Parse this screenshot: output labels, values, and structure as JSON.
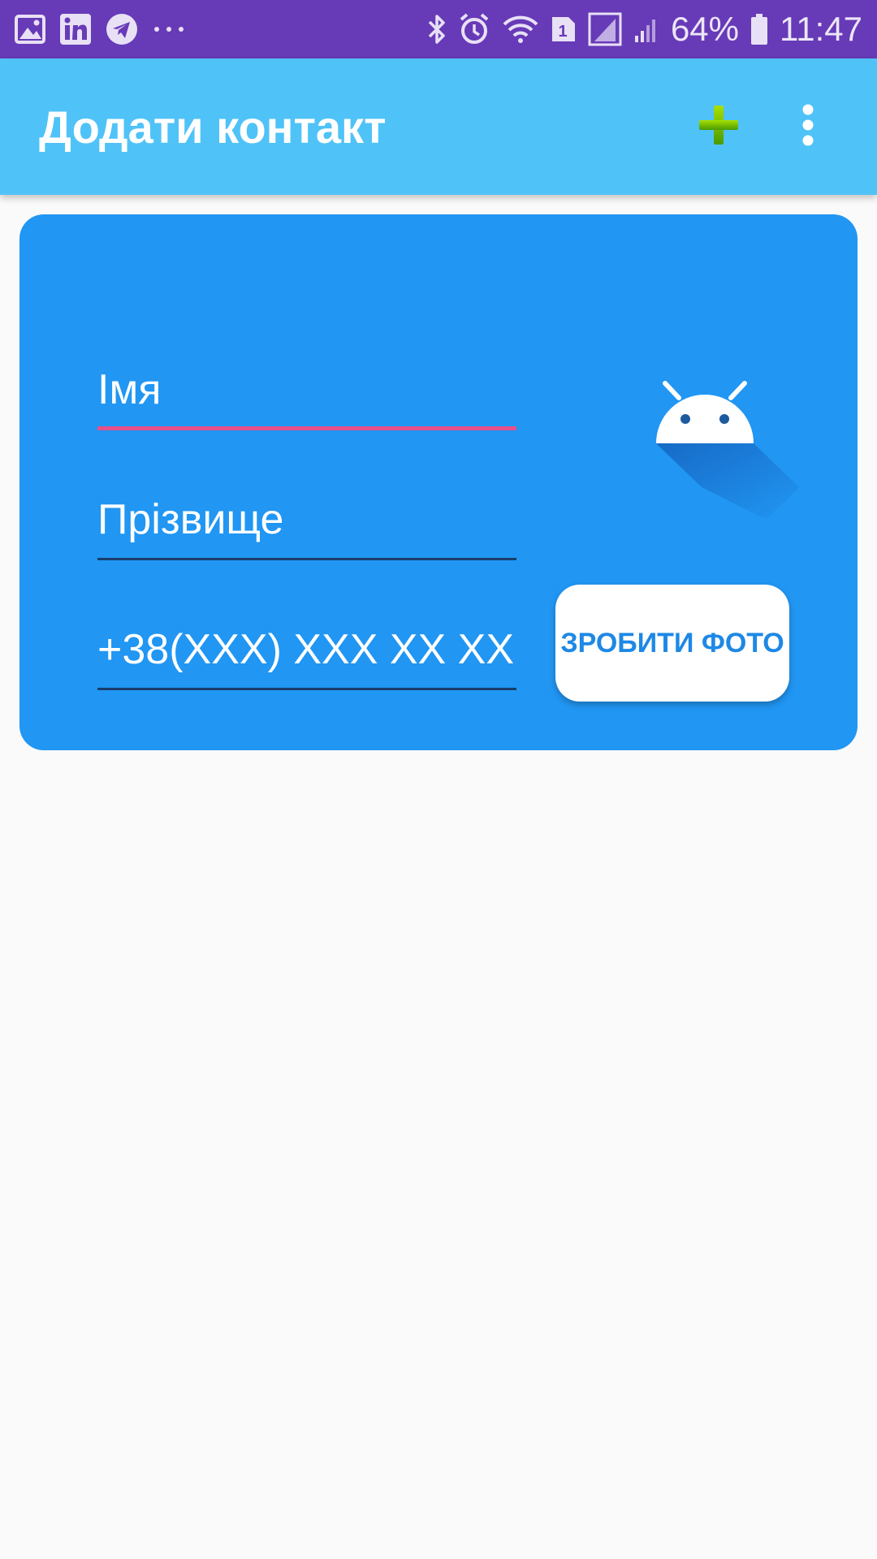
{
  "status_bar": {
    "battery": "64%",
    "time": "11:47",
    "sim_badge": "1",
    "notification_icons": [
      "gallery-icon",
      "linkedin-icon",
      "telegram-icon",
      "more-notifications-icon"
    ],
    "system_icons": [
      "bluetooth-icon",
      "alarm-icon",
      "wifi-icon",
      "sim-icon",
      "signal-icon",
      "signal-2-icon",
      "battery-icon"
    ]
  },
  "app_bar": {
    "title": "Додати контакт",
    "actions": [
      "add-icon",
      "overflow-menu-icon"
    ],
    "add_icon_color": "#7cc800",
    "background": "#4fc3f7"
  },
  "form": {
    "first_name": {
      "placeholder": "Імя",
      "value": ""
    },
    "last_name": {
      "placeholder": "Прізвище",
      "value": ""
    },
    "phone": {
      "placeholder": "+38(XXX) XXX XX XX",
      "value": ""
    },
    "photo_button_label": "ЗРОБИТИ ФОТО",
    "avatar_icon": "android-icon",
    "card_color": "#2196f3",
    "focus_color": "#e8508a"
  },
  "colors": {
    "status_bar": "#673ab7",
    "background": "#fafafa"
  }
}
